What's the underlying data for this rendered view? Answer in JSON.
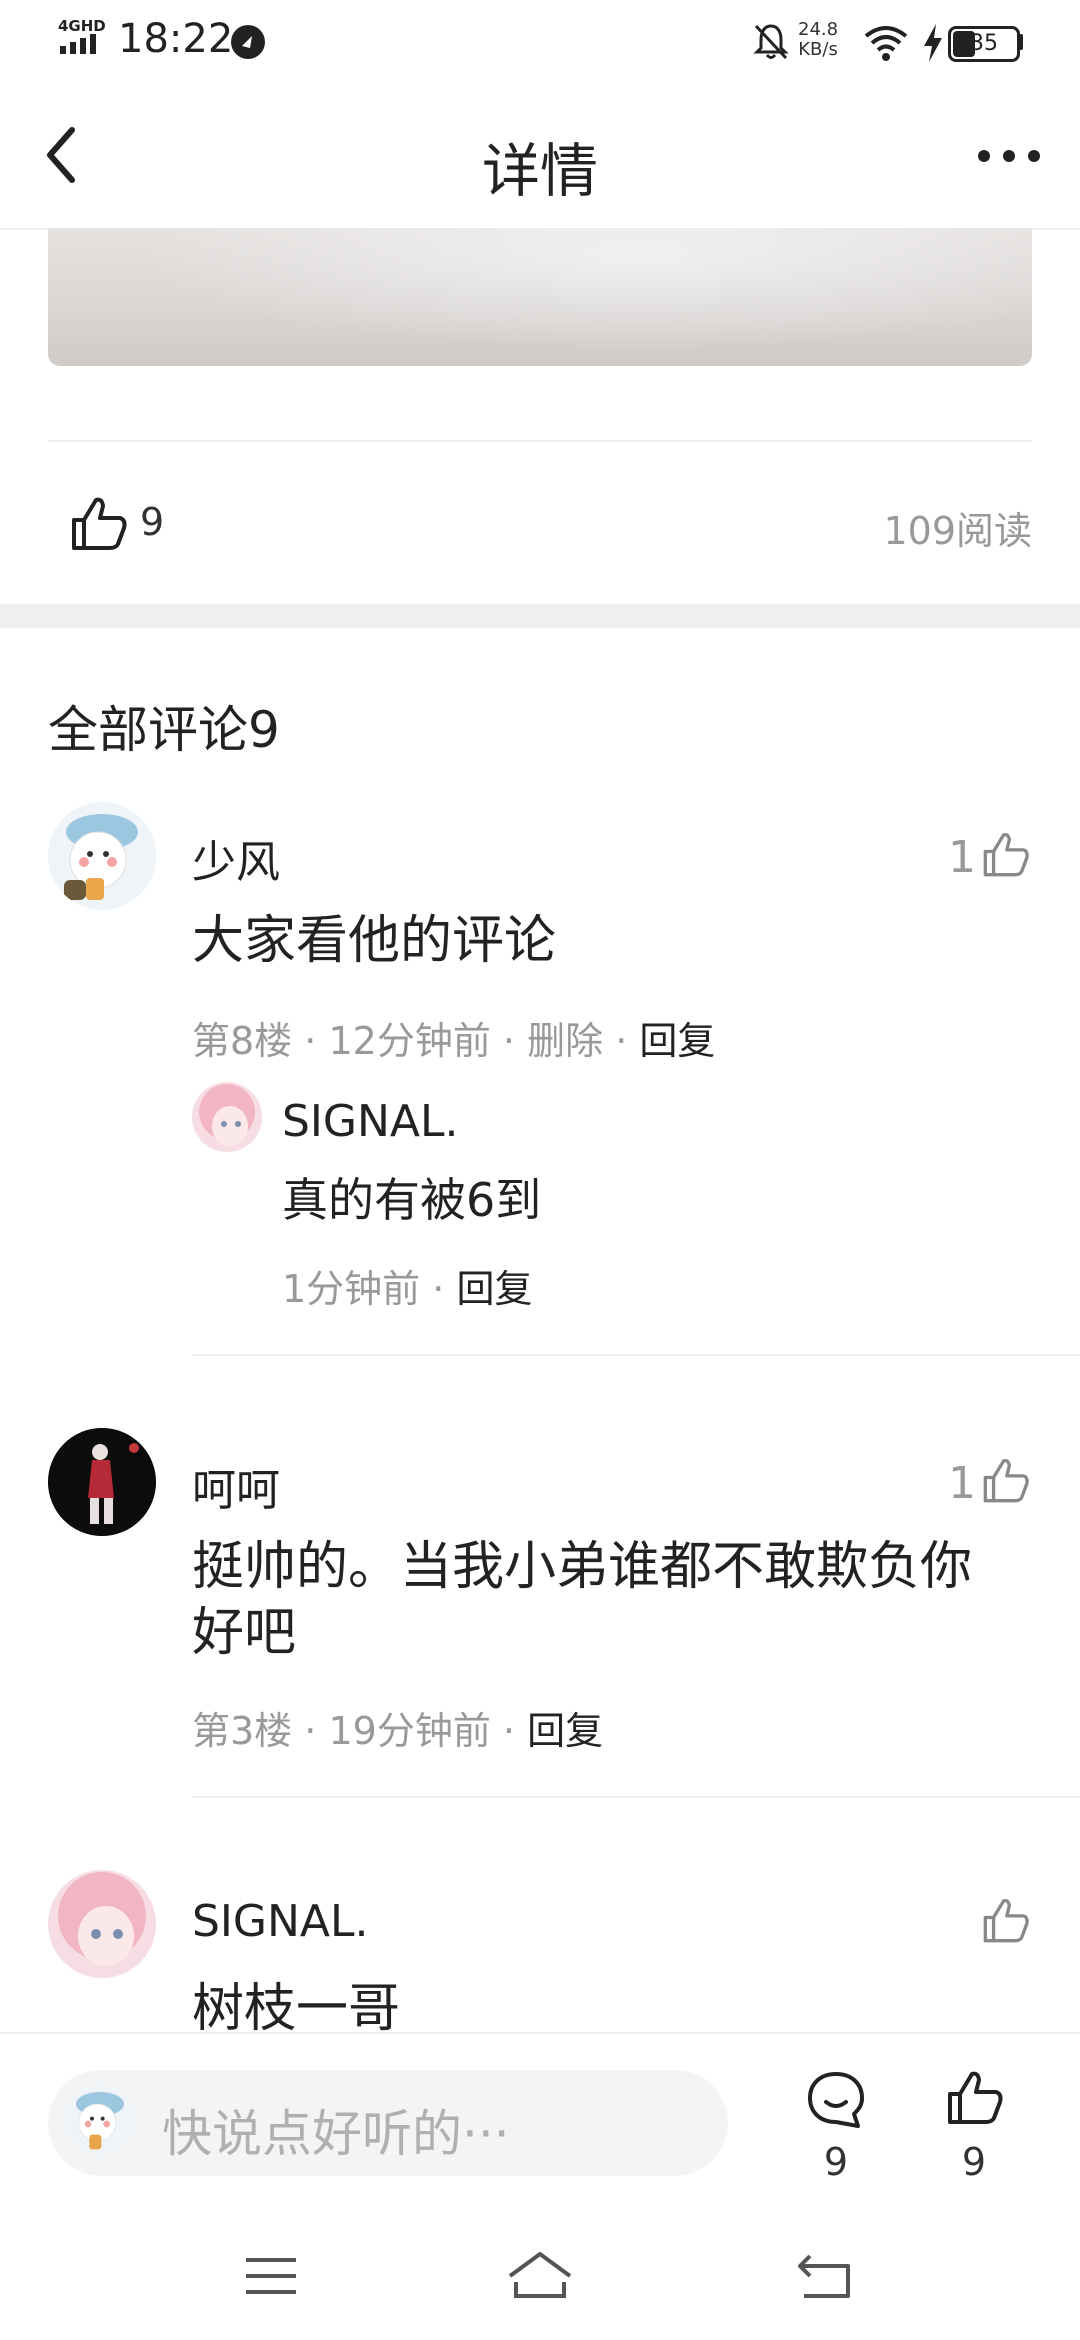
{
  "status_bar": {
    "network": "4GHD",
    "time": "18:22",
    "speed_value": "24.8",
    "speed_unit": "KB/s",
    "battery": "35"
  },
  "header": {
    "title": "详情",
    "back_icon": "chevron-left-icon",
    "more_icon": "more-dots-icon"
  },
  "post": {
    "like_count": "9",
    "reads": "109阅读"
  },
  "comments_section": {
    "title": "全部评论9",
    "comments": [
      {
        "name": "少风",
        "text": "大家看他的评论",
        "meta_floor": "第8楼",
        "meta_time": "12分钟前",
        "meta_delete": "删除",
        "meta_reply": "回复",
        "likes": "1",
        "replies": [
          {
            "name": "SIGNAL.",
            "text": "真的有被6到",
            "meta_time": "1分钟前",
            "meta_reply": "回复"
          }
        ]
      },
      {
        "name": "呵呵",
        "text_line1": "挺帅的。当我小弟谁都不敢欺负你",
        "text_line2": "好吧",
        "meta_floor": "第3楼",
        "meta_time": "19分钟前",
        "meta_reply": "回复",
        "likes": "1"
      },
      {
        "name": "SIGNAL.",
        "text": "树枝一哥",
        "likes": ""
      }
    ]
  },
  "bottom_bar": {
    "placeholder": "快说点好听的···",
    "comment_count": "9",
    "like_count": "9"
  },
  "dot": "·"
}
